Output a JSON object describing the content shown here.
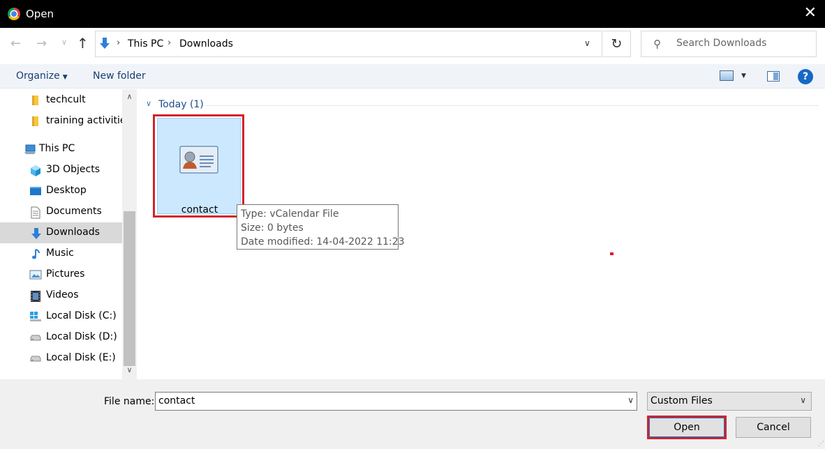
{
  "window": {
    "title": "Open"
  },
  "address": {
    "segments": [
      "This PC",
      "Downloads"
    ]
  },
  "search": {
    "placeholder": "Search Downloads"
  },
  "toolbar": {
    "organize_label": "Organize",
    "new_folder_label": "New folder",
    "help_label": "?"
  },
  "sidebar": {
    "items": [
      {
        "label": "techcult",
        "icon": "folder-icon"
      },
      {
        "label": "training activities",
        "icon": "folder-icon"
      },
      {
        "label": "This PC",
        "icon": "computer-icon"
      },
      {
        "label": "3D Objects",
        "icon": "3d-objects-icon"
      },
      {
        "label": "Desktop",
        "icon": "desktop-icon"
      },
      {
        "label": "Documents",
        "icon": "documents-icon"
      },
      {
        "label": "Downloads",
        "icon": "downloads-icon",
        "selected": true
      },
      {
        "label": "Music",
        "icon": "music-icon"
      },
      {
        "label": "Pictures",
        "icon": "pictures-icon"
      },
      {
        "label": "Videos",
        "icon": "videos-icon"
      },
      {
        "label": "Local Disk (C:)",
        "icon": "windows-drive-icon"
      },
      {
        "label": "Local Disk (D:)",
        "icon": "drive-icon"
      },
      {
        "label": "Local Disk (E:)",
        "icon": "drive-icon"
      }
    ]
  },
  "main": {
    "group_label": "Today (1)",
    "file": {
      "name": "contact",
      "icon": "contact-card-icon"
    },
    "tooltip": {
      "type": "Type: vCalendar File",
      "size": "Size: 0 bytes",
      "modified": "Date modified: 14-04-2022 11:23"
    }
  },
  "footer": {
    "file_name_label": "File name:",
    "file_name_value": "contact",
    "file_type_value": "Custom Files",
    "open_label": "Open",
    "cancel_label": "Cancel"
  },
  "colors": {
    "highlight": "#d3222a",
    "selection": "#cce8ff",
    "accent": "#1668c6"
  }
}
